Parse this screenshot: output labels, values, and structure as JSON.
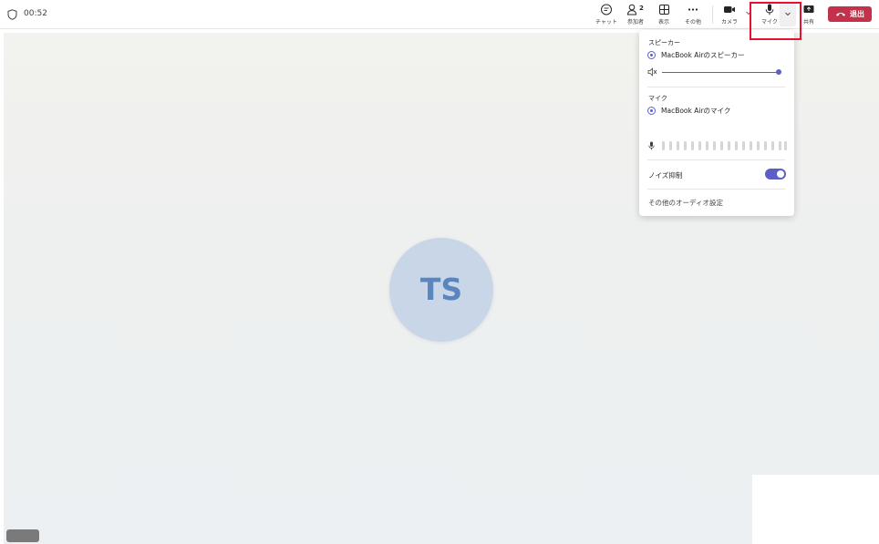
{
  "meeting": {
    "timer": "00:52"
  },
  "toolbar": {
    "chat_label": "チャット",
    "participants_label": "参加者",
    "participants_count": "2",
    "view_label": "表示",
    "more_label": "その他",
    "camera_label": "カメラ",
    "mic_label": "マイク",
    "share_label": "共有",
    "leave_label": "退出"
  },
  "stage": {
    "avatar_initials": "TS"
  },
  "audio_panel": {
    "speaker_header": "スピーカー",
    "speaker_device": "MacBook Airのスピーカー",
    "speaker_volume": 1.0,
    "mic_header": "マイク",
    "mic_device": "MacBook Airのマイク",
    "noise_suppression_label": "ノイズ抑制",
    "noise_suppression_on": true,
    "more_settings_link": "その他のオーディオ設定"
  },
  "colors": {
    "accent": "#5b5fc7",
    "leave": "#c4314b",
    "highlight": "#e8112d",
    "avatar_bg": "#c8d6e8",
    "avatar_text": "#5b86bd"
  },
  "icons": [
    "shield-icon",
    "chat-icon",
    "people-icon",
    "grid-icon",
    "more-icon",
    "video-icon",
    "mic-icon",
    "chevron-down-icon",
    "share-icon",
    "phone-hangup-icon",
    "speaker-muted-icon"
  ]
}
